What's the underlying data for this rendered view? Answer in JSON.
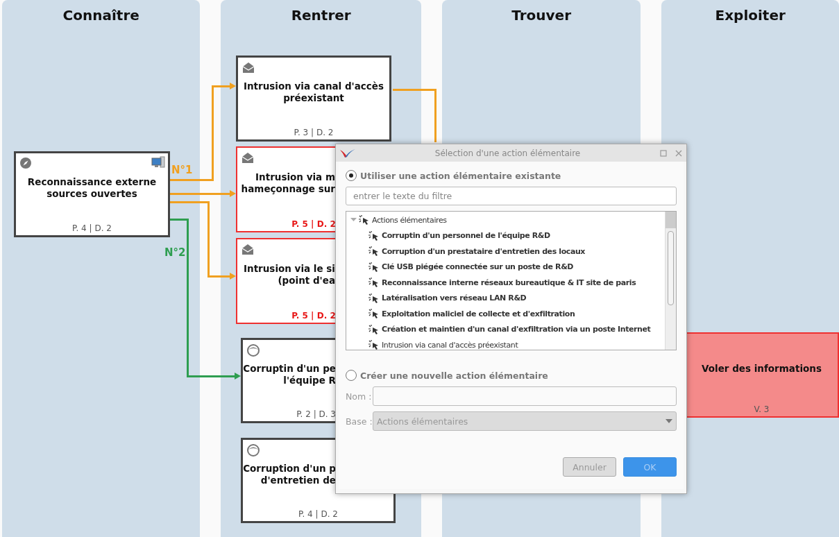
{
  "lanes": [
    {
      "title": "Connaître"
    },
    {
      "title": "Rentrer"
    },
    {
      "title": "Trouver"
    },
    {
      "title": "Exploiter"
    }
  ],
  "cards": [
    {
      "kind": "source",
      "title_lines": [
        "Reconnaissance externe",
        "sources ouvertes"
      ],
      "footer": "P. 4 | D. 2",
      "critical": false
    },
    {
      "kind": "access",
      "title_lines": [
        "Intrusion via canal d'accès",
        "préexistant"
      ],
      "footer": "P. 3 | D. 2",
      "critical": false
    },
    {
      "kind": "access",
      "title_lines": [
        "Intrusion via m",
        "hameçonnage sur"
      ],
      "footer": "P. 5 | D. 2",
      "critical": true
    },
    {
      "kind": "access",
      "title_lines": [
        "Intrusion via le si",
        "(point d'ea"
      ],
      "footer": "P. 5 | D. 2",
      "critical": true
    },
    {
      "kind": "person",
      "title_lines": [
        "Corruptin d'un pe",
        "l'équipe R"
      ],
      "footer": "P. 2 | D. 3",
      "critical": false
    },
    {
      "kind": "person",
      "title_lines": [
        "Corruption d'un p",
        "d'entretien de"
      ],
      "footer": "P. 4 | D. 2",
      "critical": false
    },
    {
      "kind": "objective",
      "title_lines": [
        "Voler des informations"
      ],
      "footer": "V. 3",
      "critical": true
    }
  ],
  "connectors": [
    {
      "label": "N°1",
      "color": "#f0a020"
    },
    {
      "color": "#f0a020"
    },
    {
      "color": "#f0a020"
    },
    {
      "label": "N°2",
      "color": "#2e9e50"
    },
    {
      "color": "#f0a020"
    }
  ],
  "dialog": {
    "title": "Sélection d'une action élémentaire",
    "use_existing": {
      "label": "Utiliser une action élémentaire existante",
      "selected": true
    },
    "filter": {
      "placeholder": "entrer le texte du filtre"
    },
    "tree": [
      {
        "label": "Actions élémentaires",
        "expanded": true,
        "children": [
          {
            "label": "Corruptin d'un personnel de l'équipe R&D",
            "bold": true
          },
          {
            "label": "Corruption d'un prestataire d'entretien des locaux",
            "bold": true
          },
          {
            "label": "Clé USB piégée connectée sur un poste de R&D",
            "bold": true
          },
          {
            "label": "Reconnaissance interne réseaux bureautique & IT site de paris",
            "bold": true
          },
          {
            "label": "Latéralisation vers réseau LAN R&D",
            "bold": true
          },
          {
            "label": "Exploitation maliciel de collecte et d'exfiltration",
            "bold": true
          },
          {
            "label": "Création et maintien d'un canal d'exfiltration via un poste Internet",
            "bold": true
          },
          {
            "label": "Intrusion via canal d'accès préexistant",
            "bold": false
          }
        ]
      }
    ],
    "create_new": {
      "label": "Créer une nouvelle action élémentaire",
      "selected": false
    },
    "name_field": {
      "label": "Nom :"
    },
    "base_field": {
      "label": "Base :",
      "value": "Actions élémentaires",
      "disabled": true
    },
    "buttons": [
      {
        "label": "Annuler",
        "kind": "cancel"
      },
      {
        "label": "OK",
        "kind": "primary"
      }
    ]
  }
}
